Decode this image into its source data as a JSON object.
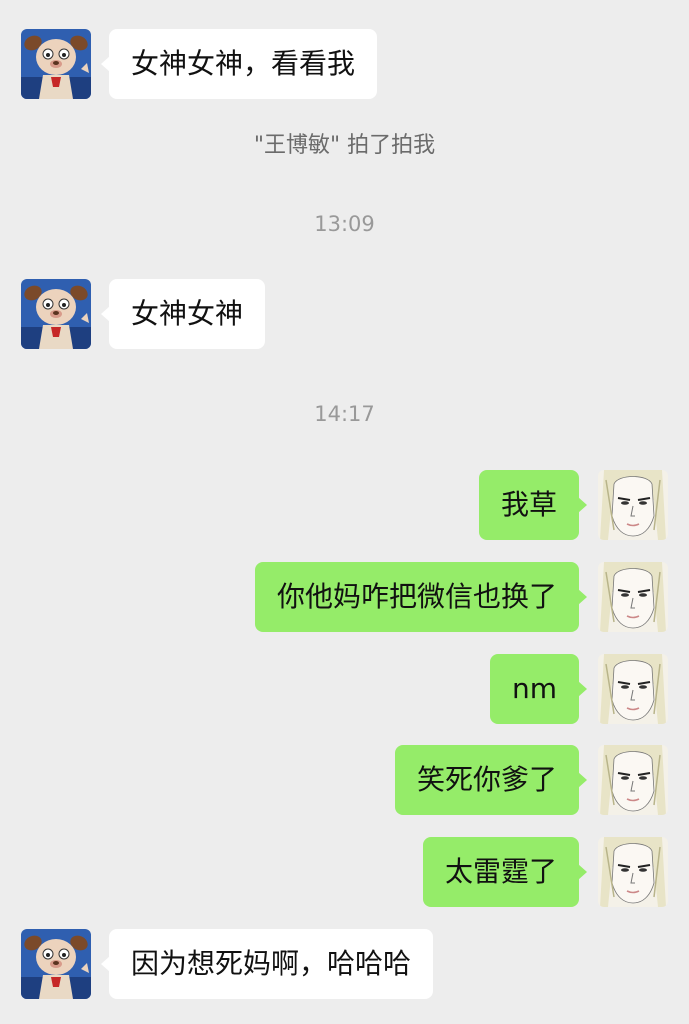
{
  "messages": [
    {
      "text": "女神女神，看看我"
    },
    {
      "text": "女神女神"
    },
    {
      "text": "我草"
    },
    {
      "text": "你他妈咋把微信也换了"
    },
    {
      "text": "nm"
    },
    {
      "text": "笑死你爹了"
    },
    {
      "text": "太雷霆了"
    },
    {
      "text": "因为想死妈啊，哈哈哈"
    }
  ],
  "system": {
    "pat_notice": "\"王博敏\" 拍了拍我",
    "time1": "13:09",
    "time2": "14:17"
  },
  "colors": {
    "background": "#ededed",
    "incoming_bubble": "#ffffff",
    "outgoing_bubble": "#95ec69",
    "system_text": "#999999"
  },
  "icons": {
    "incoming_avatar": "cartoon-dog-avatar-icon",
    "outgoing_avatar": "sketch-portrait-avatar-icon"
  }
}
